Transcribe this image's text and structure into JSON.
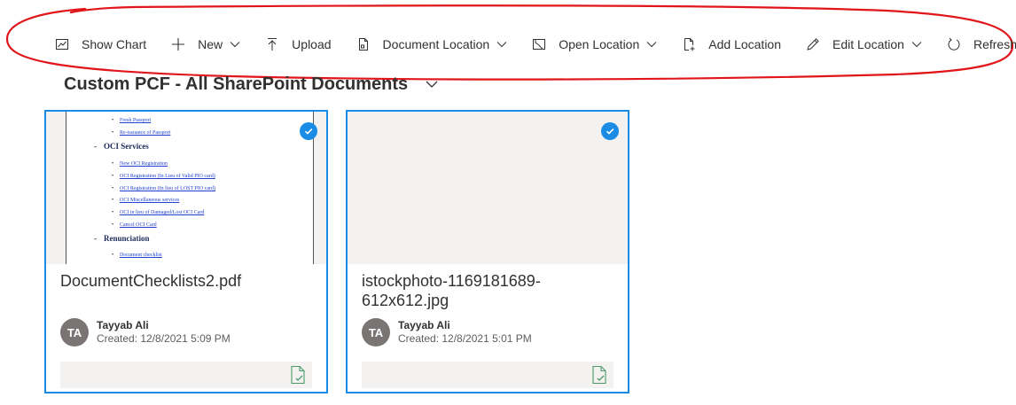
{
  "toolbar": {
    "show_chart": "Show Chart",
    "new": "New",
    "upload": "Upload",
    "document_location": "Document Location",
    "open_location": "Open Location",
    "add_location": "Add Location",
    "edit_location": "Edit Location",
    "refresh": "Refresh"
  },
  "view": {
    "title": "Custom PCF - All SharePoint Documents"
  },
  "cards": [
    {
      "file_name": "DocumentChecklists2.pdf",
      "author_initials": "TA",
      "author": "Tayyab Ali",
      "created": "Created: 12/8/2021 5:09 PM",
      "preview": {
        "links_top": [
          "Fresh Passport",
          "Re-issuance of Passport"
        ],
        "section1": "OCI Services",
        "links_mid": [
          "New OCI Registration",
          "OCI Registration (In Lieu of Valid PIO card)",
          "OCI Registration (In lieu of LOST PIO card)",
          "OCI Miscellaneous services",
          "OCI in lieu of Damaged/Lost OCI Card",
          "Cancel OCI Card"
        ],
        "section2": "Renunciation",
        "links_bottom": [
          "Document checklist"
        ]
      }
    },
    {
      "file_name": "istockphoto-1169181689-612x612.jpg",
      "author_initials": "TA",
      "author": "Tayyab Ali",
      "created": "Created: 12/8/2021 5:01 PM"
    }
  ],
  "colors": {
    "accent": "#1a8ce5",
    "annotation": "#e0161b",
    "avatar": "#7a7574"
  }
}
